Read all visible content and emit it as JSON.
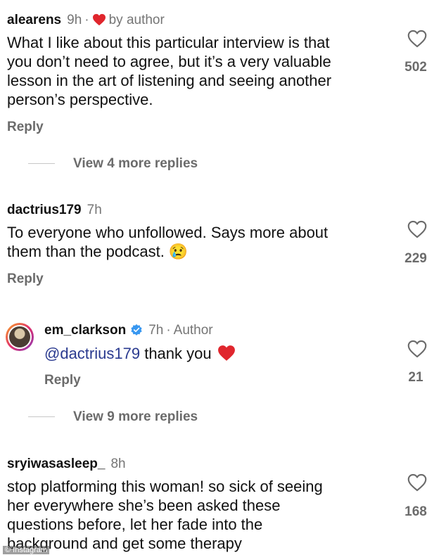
{
  "comments": [
    {
      "username": "alearens",
      "time": "9h",
      "separator": "·",
      "by_author": "by author",
      "text_lines": [
        "What I like about this particular interview is that",
        "you don’t need to agree, but it’s a very valuable",
        "lesson in the art of listening and seeing another",
        "person’s perspective."
      ],
      "reply_label": "Reply",
      "like_count": "502",
      "view_replies": "View 4 more replies"
    },
    {
      "username": "dactrius179",
      "time": "7h",
      "text_lines": [
        "To everyone who unfollowed. Says more about",
        "them than the podcast. 😢"
      ],
      "reply_label": "Reply",
      "like_count": "229"
    },
    {
      "username": "em_clarkson",
      "time": "7h",
      "separator": "·",
      "author_label": "Author",
      "mention": "@dactrius179",
      "text": "thank you",
      "reply_label": "Reply",
      "like_count": "21",
      "view_replies": "View 9 more replies"
    },
    {
      "username": "sryiwasasleep_",
      "time": "8h",
      "text_lines": [
        "stop platforming this woman! so sick of seeing",
        "her everywhere she’s been asked these",
        "questions before, let her fade into the",
        "background and get some therapy"
      ],
      "like_count": "168"
    }
  ],
  "watermark": "© Instagram",
  "colors": {
    "text": "#111111",
    "muted": "#757575",
    "mention": "#2a3a8f",
    "heart_red": "#e0262d",
    "verified_blue": "#3897f0"
  },
  "icons": {
    "like": "heart-outline-icon",
    "author_like": "red-heart-icon",
    "verified": "verified-badge-icon"
  }
}
